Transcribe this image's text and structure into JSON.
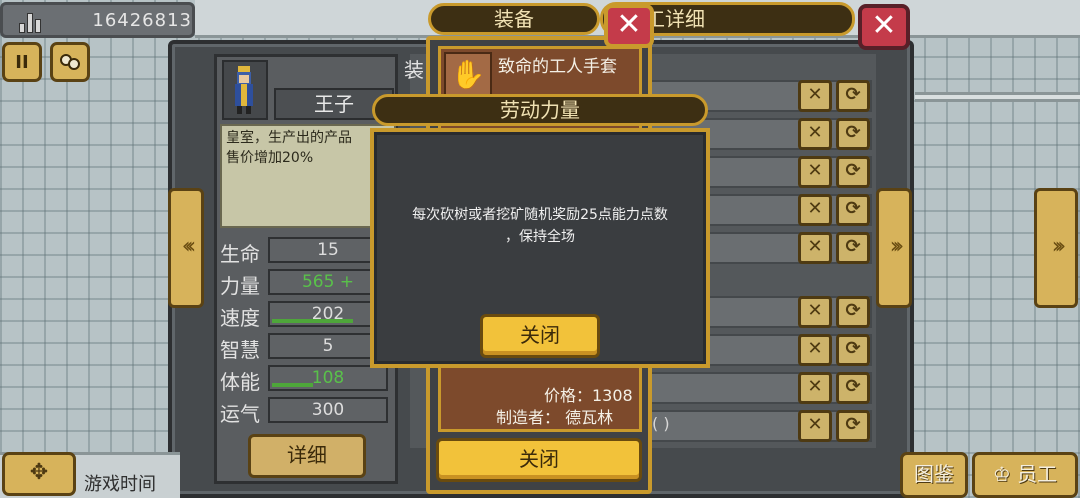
{
  "hud": {
    "money": "16426813",
    "pause_icon": "pause-icon",
    "group_icon": "people-icon"
  },
  "employee": {
    "panel_title": "员工详细",
    "name": "王子",
    "description": "皇室，生产出的产品\n售价增加20%",
    "equipment_label": "装",
    "stats": [
      {
        "label": "生命",
        "value": "15",
        "fill": 0.0
      },
      {
        "label": "力量",
        "value": "565 +",
        "fill": 0.0
      },
      {
        "label": "速度",
        "value": "202",
        "fill": 0.7
      },
      {
        "label": "智慧",
        "value": "5",
        "fill": 0.0
      },
      {
        "label": "体能",
        "value": "108",
        "fill": 0.35
      },
      {
        "label": "运气",
        "value": "300",
        "fill": 0.0
      }
    ],
    "detail_button": "详细",
    "slot_paren": "(   )"
  },
  "bottom": {
    "game_time_label": "游戏时间",
    "codex_label": "图鉴",
    "staff_label": "员工"
  },
  "equipment": {
    "title": "装备",
    "item_name": "致命的工人手套",
    "price": "价格：1308",
    "maker": "制造者： 德瓦林",
    "close_button": "关闭"
  },
  "skill_dialog": {
    "title": "劳动力量",
    "description": "每次砍树或者挖矿随机奖励25点能力点数\n，保持全场",
    "close_button": "关闭"
  },
  "colors": {
    "gold": "#c99a2c",
    "button_yellow": "#f2c23a",
    "close_red": "#c43b4a",
    "panel_dark": "#3a3d40"
  }
}
